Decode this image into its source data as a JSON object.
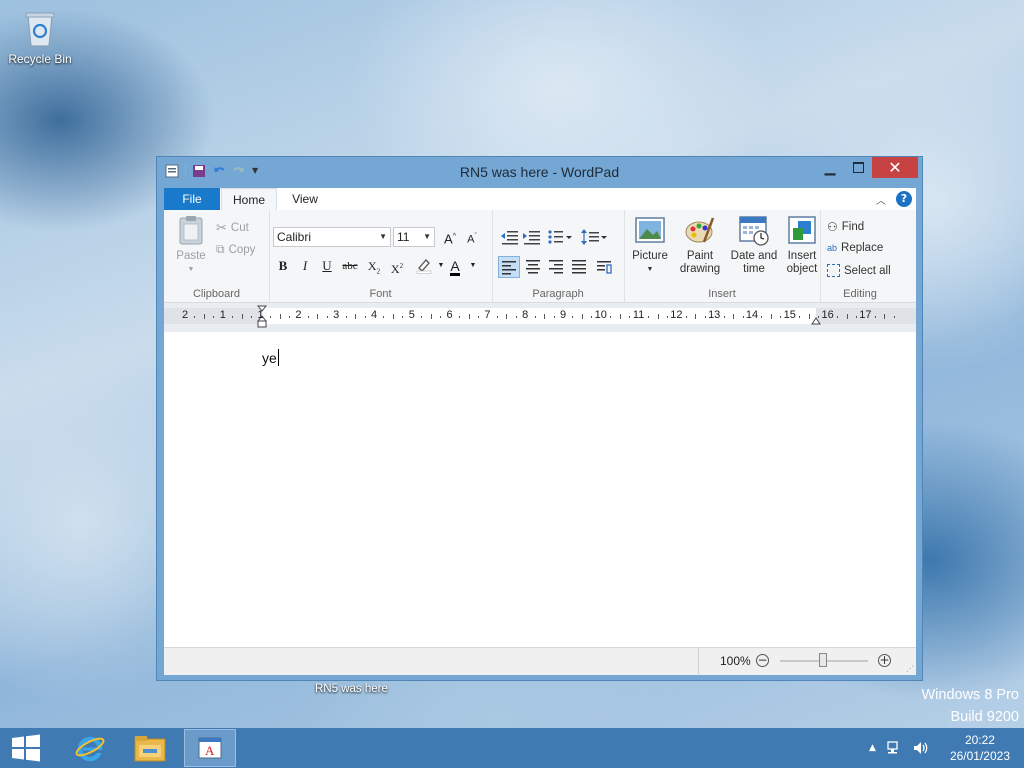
{
  "desktop": {
    "recycle_bin_label": "Recycle Bin",
    "watermark_line1": "Windows 8 Pro",
    "watermark_line2": "Build 9200",
    "taskbar_caption": "RN5 was here"
  },
  "window": {
    "title": "RN5 was here - WordPad",
    "tabs": {
      "file": "File",
      "home": "Home",
      "view": "View"
    }
  },
  "ribbon": {
    "clipboard": {
      "label": "Clipboard",
      "paste": "Paste",
      "cut": "Cut",
      "copy": "Copy"
    },
    "font": {
      "label": "Font",
      "family": "Calibri",
      "size": "11"
    },
    "paragraph": {
      "label": "Paragraph"
    },
    "insert": {
      "label": "Insert",
      "picture": "Picture",
      "paint_line1": "Paint",
      "paint_line2": "drawing",
      "datetime_line1": "Date and",
      "datetime_line2": "time",
      "object_line1": "Insert",
      "object_line2": "object"
    },
    "editing": {
      "label": "Editing",
      "find": "Find",
      "replace": "Replace",
      "select_all": "Select all"
    }
  },
  "ruler": {
    "numbers": [
      "2",
      "1",
      "1",
      "2",
      "3",
      "4",
      "5",
      "6",
      "7",
      "8",
      "9",
      "10",
      "11",
      "12",
      "13",
      "14",
      "15",
      "16",
      "17"
    ]
  },
  "document": {
    "text": "ye"
  },
  "status": {
    "zoom": "100%",
    "zoom_level_percent": 100
  },
  "taskbar": {
    "time": "20:22",
    "date": "26/01/2023"
  },
  "colors": {
    "file_tab": "#1979ca",
    "close_button": "#c74242",
    "taskbar": "#3f7ab3",
    "window_frame": "#74a7d3"
  }
}
